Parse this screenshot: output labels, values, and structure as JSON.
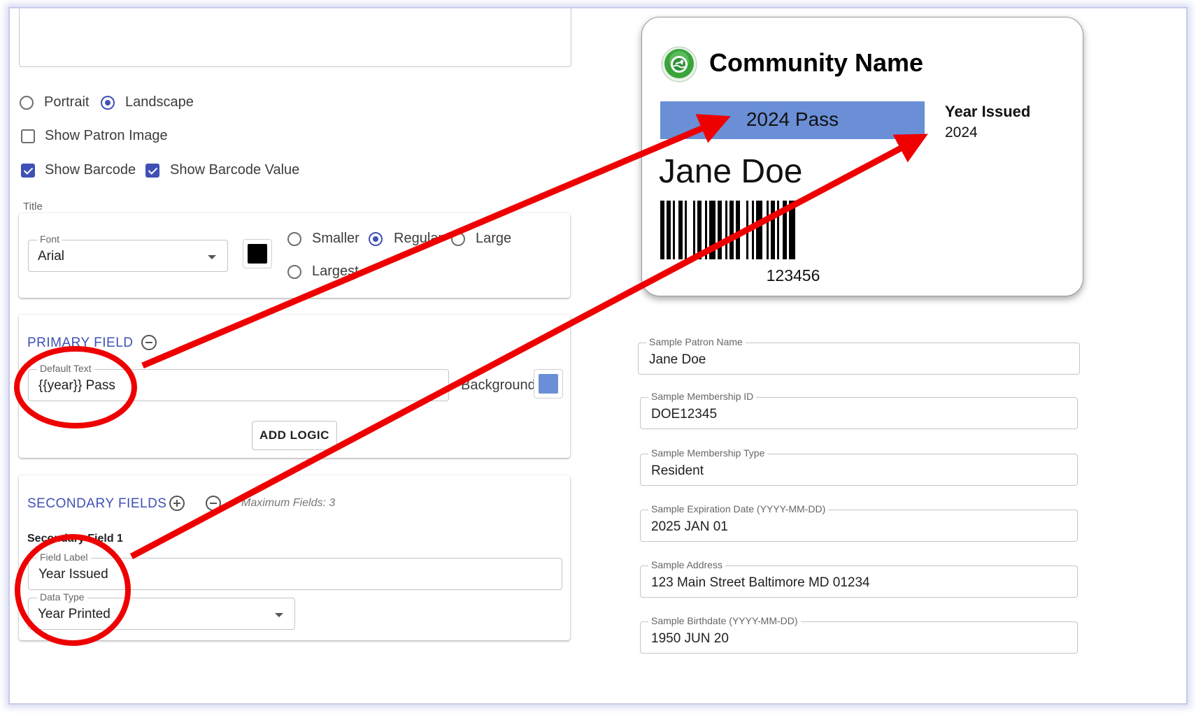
{
  "orientation": {
    "portrait": "Portrait",
    "landscape": "Landscape",
    "selected": "landscape"
  },
  "options": {
    "show_patron_image": {
      "label": "Show Patron Image",
      "checked": false
    },
    "show_barcode": {
      "label": "Show Barcode",
      "checked": true
    },
    "show_barcode_value": {
      "label": "Show Barcode Value",
      "checked": true
    }
  },
  "title_section": {
    "heading": "Title",
    "font_label": "Font",
    "font_value": "Arial",
    "color": "#000000",
    "sizes": {
      "smaller": "Smaller",
      "regular": "Regular",
      "large": "Large",
      "largest": "Largest",
      "selected": "regular"
    }
  },
  "primary_field": {
    "heading": "PRIMARY FIELD",
    "default_text_label": "Default Text",
    "default_text_value": "{{year}} Pass",
    "background_label": "Background",
    "background_color": "#6a8fd6",
    "add_logic": "ADD LOGIC"
  },
  "secondary_fields": {
    "heading": "SECONDARY FIELDS",
    "max_note": "Maximum Fields: 3",
    "field1_title": "Secondary Field 1",
    "field_label_label": "Field Label",
    "field_label_value": "Year Issued",
    "data_type_label": "Data Type",
    "data_type_value": "Year Printed"
  },
  "pass_preview": {
    "community_name": "Community Name",
    "primary_text": "2024 Pass",
    "primary_bg": "#6a8fd6",
    "secondary_label": "Year Issued",
    "secondary_value": "2024",
    "patron_name": "Jane Doe",
    "barcode_value": "123456"
  },
  "samples": [
    {
      "label": "Sample Patron Name",
      "value": "Jane Doe"
    },
    {
      "label": "Sample Membership ID",
      "value": "DOE12345"
    },
    {
      "label": "Sample Membership Type",
      "value": "Resident"
    },
    {
      "label": "Sample Expiration Date (YYYY-MM-DD)",
      "value": "2025 JAN 01"
    },
    {
      "label": "Sample Address",
      "value": "123 Main Street Baltimore MD 01234"
    },
    {
      "label": "Sample Birthdate (YYYY-MM-DD)",
      "value": "1950 JUN 20"
    }
  ],
  "annotation_color": "#ee0000"
}
